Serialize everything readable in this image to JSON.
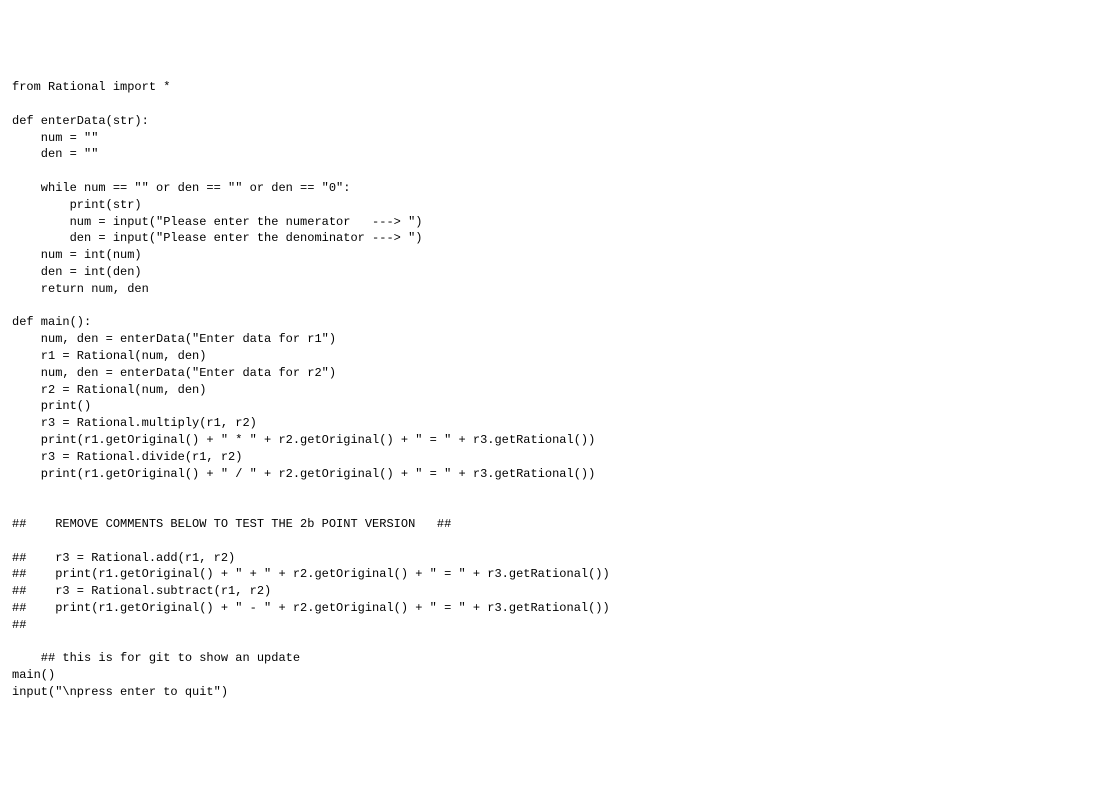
{
  "code": {
    "lines": [
      "from Rational import *",
      "",
      "def enterData(str):",
      "    num = \"\"",
      "    den = \"\"",
      "",
      "    while num == \"\" or den == \"\" or den == \"0\":",
      "        print(str)",
      "        num = input(\"Please enter the numerator   ---> \")",
      "        den = input(\"Please enter the denominator ---> \")",
      "    num = int(num)",
      "    den = int(den)",
      "    return num, den",
      "",
      "def main():",
      "    num, den = enterData(\"Enter data for r1\")",
      "    r1 = Rational(num, den)",
      "    num, den = enterData(\"Enter data for r2\")",
      "    r2 = Rational(num, den)",
      "    print()",
      "    r3 = Rational.multiply(r1, r2)",
      "    print(r1.getOriginal() + \" * \" + r2.getOriginal() + \" = \" + r3.getRational())",
      "    r3 = Rational.divide(r1, r2)",
      "    print(r1.getOriginal() + \" / \" + r2.getOriginal() + \" = \" + r3.getRational())",
      "",
      "",
      "##    REMOVE COMMENTS BELOW TO TEST THE 2b POINT VERSION   ##",
      "",
      "##    r3 = Rational.add(r1, r2)",
      "##    print(r1.getOriginal() + \" + \" + r2.getOriginal() + \" = \" + r3.getRational())",
      "##    r3 = Rational.subtract(r1, r2)",
      "##    print(r1.getOriginal() + \" - \" + r2.getOriginal() + \" = \" + r3.getRational())",
      "##",
      "",
      "    ## this is for git to show an update",
      "main()",
      "input(\"\\npress enter to quit\")"
    ]
  }
}
